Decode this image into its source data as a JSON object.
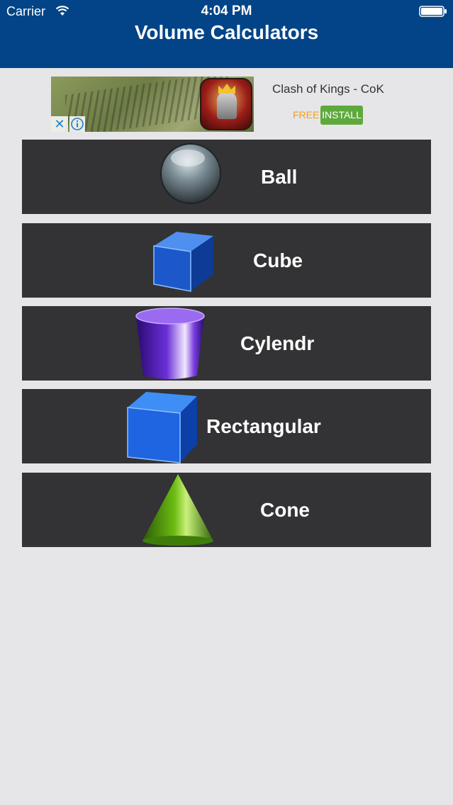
{
  "status_bar": {
    "carrier": "Carrier",
    "time": "4:04 PM"
  },
  "header": {
    "title": "Volume Calculators",
    "color": "#024487"
  },
  "ad": {
    "app_name": "Clash of Kings - CoK",
    "price": "FREE",
    "install_label": "INSTALL",
    "install_color": "#5ea93c"
  },
  "calculators": [
    {
      "label": "Ball",
      "icon": "sphere-icon"
    },
    {
      "label": "Cube",
      "icon": "cube-icon"
    },
    {
      "label": "Cylendr",
      "icon": "cylinder-icon"
    },
    {
      "label": "Rectangular",
      "icon": "rectangular-prism-icon"
    },
    {
      "label": "Cone",
      "icon": "cone-icon"
    }
  ]
}
